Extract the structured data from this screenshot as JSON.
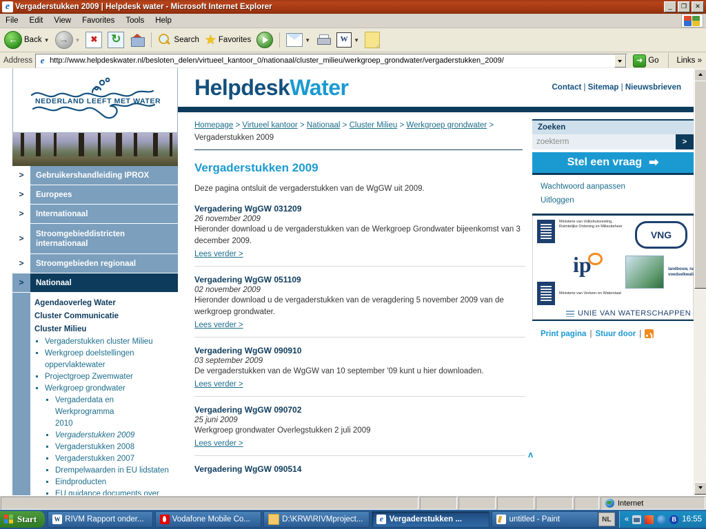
{
  "window": {
    "title": "Vergaderstukken 2009 | Helpdesk water - Microsoft Internet Explorer",
    "minimize": "_",
    "maximize": "❐",
    "close": "✕"
  },
  "menubar": [
    "File",
    "Edit",
    "View",
    "Favorites",
    "Tools",
    "Help"
  ],
  "toolbar": {
    "back": "Back",
    "search": "Search",
    "favorites": "Favorites"
  },
  "address": {
    "label": "Address",
    "url": "http://www.helpdeskwater.nl/besloten_delen/virtueel_kantoor_0/nationaal/cluster_milieu/werkgroep_grondwater/vergaderstukken_2009/",
    "go": "Go",
    "links": "Links",
    "links_chevron": "»"
  },
  "site": {
    "logo_text": "NEDERLAND LEEFT MET WATER",
    "brand_part1": "Helpdesk",
    "brand_part2": "Water",
    "toplinks": [
      "Contact",
      "Sitemap",
      "Nieuwsbrieven"
    ]
  },
  "leftnav": {
    "items": [
      {
        "label": "Gebruikershandleiding IPROX",
        "chevron": ">",
        "active": false
      },
      {
        "label": "Europees",
        "chevron": ">",
        "active": false
      },
      {
        "label": "Internationaal",
        "chevron": ">",
        "active": false
      },
      {
        "label": "Stroomgebieddistricten internationaal",
        "chevron": ">",
        "active": false
      },
      {
        "label": "Stroomgebieden regionaal",
        "chevron": ">",
        "active": false
      },
      {
        "label": "Nationaal",
        "chevron": ">",
        "active": true
      }
    ],
    "sub": [
      {
        "level": "head",
        "label": "Agendaoverleg Water"
      },
      {
        "level": "head",
        "label": "Cluster Communicatie"
      },
      {
        "level": "head",
        "label": "Cluster Milieu"
      },
      {
        "level": "l1",
        "label": "Vergaderstukken cluster Milieu"
      },
      {
        "level": "l1",
        "label": "Werkgroep doelstellingen"
      },
      {
        "level": "l1cont",
        "label": "oppervlaktewater"
      },
      {
        "level": "l1",
        "label": "Projectgroep Zwemwater"
      },
      {
        "level": "l1",
        "label": "Werkgroep grondwater"
      },
      {
        "level": "l2",
        "label": "Vergaderdata en Werkprogramma"
      },
      {
        "level": "l2cont",
        "label": "2010"
      },
      {
        "level": "l2cur",
        "label": "Vergaderstukken 2009"
      },
      {
        "level": "l2",
        "label": "Vergaderstukken 2008"
      },
      {
        "level": "l2",
        "label": "Vergaderstukken 2007"
      },
      {
        "level": "l2",
        "label": "Drempelwaarden in EU lidstaten"
      },
      {
        "level": "l2",
        "label": "Eindproducten"
      },
      {
        "level": "l2",
        "label": "EU guidance documents over"
      }
    ]
  },
  "breadcrumb": {
    "links": [
      "Homepage",
      "Virtueel kantoor",
      "Nationaal",
      "Cluster Milieu",
      "Werkgroep grondwater"
    ],
    "current": "Vergaderstukken 2009",
    "sep": ">"
  },
  "main": {
    "title": "Vergaderstukken 2009",
    "intro": "Deze pagina ontsluit de vergaderstukken van de WgGW uit 2009.",
    "read_more": "Lees verder >",
    "to_top": "ʌ",
    "items": [
      {
        "title": "Vergadering WgGW 031209",
        "date": "26 november 2009",
        "desc": "Hieronder download u de vergaderstukken van de Werkgroep Grondwater bijeenkomst van 3 december 2009."
      },
      {
        "title": "Vergadering WgGW 051109",
        "date": "02 november 2009",
        "desc": "Hieronder download u de vergaderstukken van de veragdering 5 november 2009 van de werkgroep grondwater."
      },
      {
        "title": "Vergadering WgGW 090910",
        "date": "03 september 2009",
        "desc": "De vergaderstukken van de WgGW van 10 september '09 kunt u hier downloaden."
      },
      {
        "title": "Vergadering WgGW 090702",
        "date": "25 juni 2009",
        "desc": "Werkgroep grondwater Overlegstukken 2 juli 2009"
      },
      {
        "title": "Vergadering WgGW 090514",
        "date": "",
        "desc": ""
      }
    ]
  },
  "rightcol": {
    "search_head": "Zoeken",
    "search_placeholder": "zoekterm",
    "search_button": ">",
    "ask_label": "Stel een vraag",
    "ask_arrow": "➡",
    "account_links": [
      "Wachtwoord aanpassen",
      "Uitloggen"
    ],
    "logos": {
      "vrom": "Ministerie van Volkshuisvesting, Ruimtelijke Ordening en Milieubeheer",
      "vng": "VNG",
      "ipo": "ip",
      "lnv": "landbouw, natuur en voedselkwaliteit",
      "venw": "Ministerie van Verkeer en Waterstaat",
      "unie": "UNIE VAN WATERSCHAPPEN"
    },
    "footlinks": [
      "Print pagina",
      "Stuur door"
    ],
    "sep": "|"
  },
  "statusbar": {
    "zone": "Internet"
  },
  "taskbar": {
    "start": "Start",
    "tasks": [
      {
        "label": "RIVM Rapport onder...",
        "icon": "word-icon",
        "active": false
      },
      {
        "label": "Vodafone Mobile Co...",
        "icon": "vodafone-icon",
        "active": false
      },
      {
        "label": "D:\\KRW\\RIVMproject...",
        "icon": "folder-icon",
        "active": false
      },
      {
        "label": "Vergaderstukken ...",
        "icon": "ie-icon",
        "active": true
      },
      {
        "label": "untitled - Paint",
        "icon": "paint-icon",
        "active": false
      }
    ],
    "lang": "NL",
    "tray_chevron": "«",
    "clock": "16:55"
  }
}
